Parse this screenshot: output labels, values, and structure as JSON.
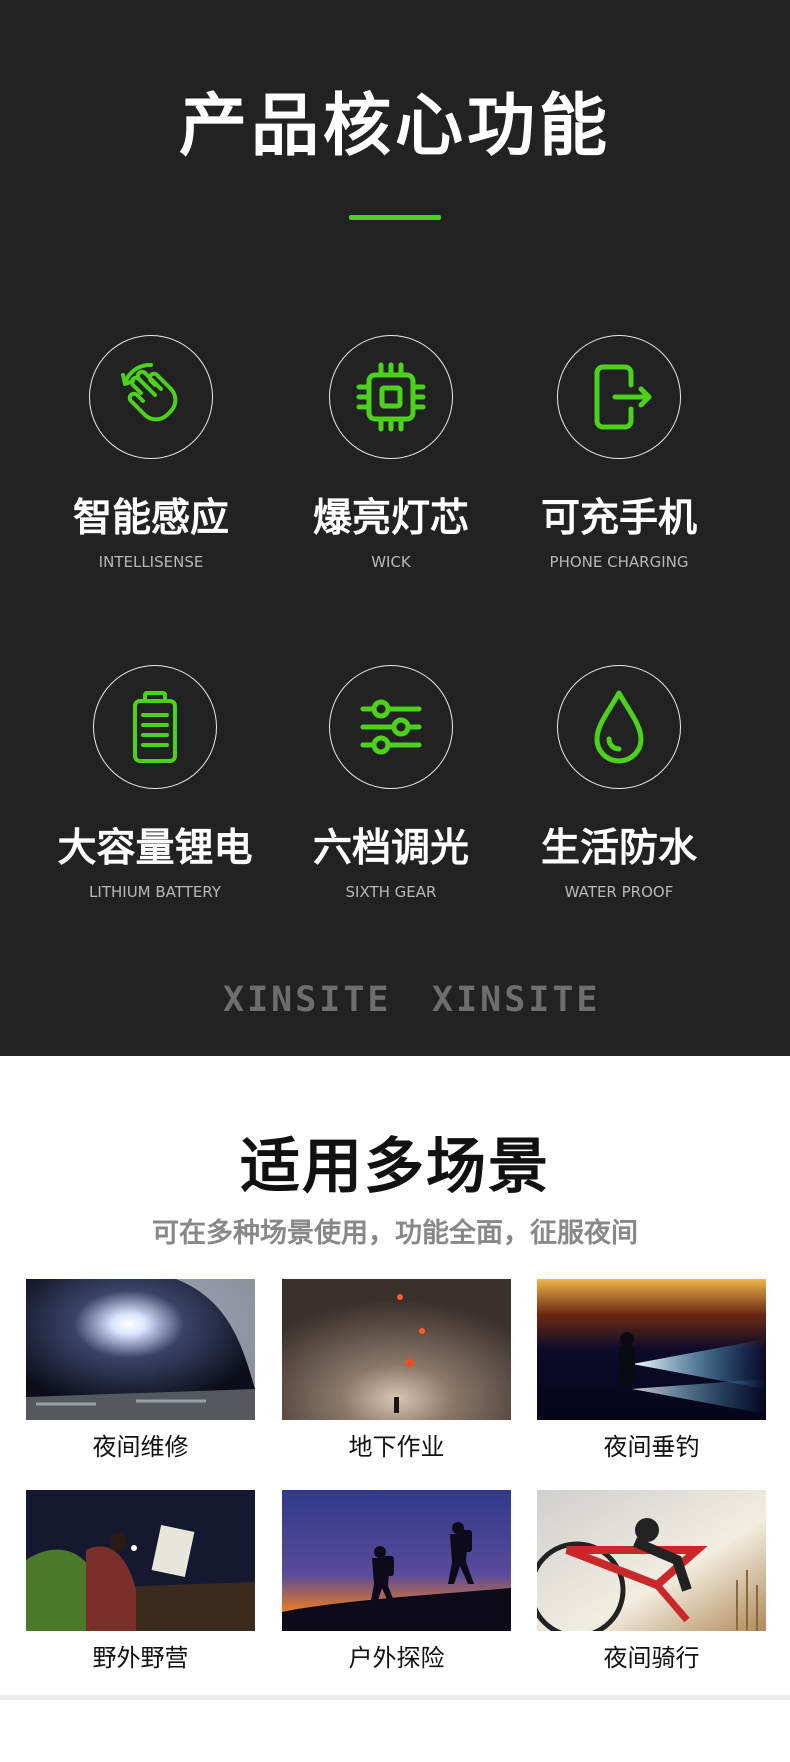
{
  "header": {
    "title": "产品核心功能"
  },
  "features": [
    {
      "cn": "智能感应",
      "en": "INTELLISENSE",
      "icon": "hand-wave-icon"
    },
    {
      "cn": "爆亮灯芯",
      "en": "WICK",
      "icon": "chip-icon"
    },
    {
      "cn": "可充手机",
      "en": "PHONE CHARGING",
      "icon": "export-icon"
    },
    {
      "cn": "大容量锂电",
      "en": "LITHIUM BATTERY",
      "icon": "battery-icon"
    },
    {
      "cn": "六档调光",
      "en": "SIXTH GEAR",
      "icon": "sliders-icon"
    },
    {
      "cn": "生活防水",
      "en": "WATER PROOF",
      "icon": "water-drop-icon"
    }
  ],
  "brand": [
    "XINSITE",
    "XINSITE"
  ],
  "scenes_section": {
    "title": "适用多场景",
    "subtitle": "可在多种场景使用，功能全面，征服夜间",
    "items": [
      {
        "label": "夜间维修"
      },
      {
        "label": "地下作业"
      },
      {
        "label": "夜间垂钓"
      },
      {
        "label": "野外野营"
      },
      {
        "label": "户外探险"
      },
      {
        "label": "夜间骑行"
      }
    ]
  },
  "colors": {
    "accent": "#4cd21d",
    "dark_bg": "#222222"
  }
}
